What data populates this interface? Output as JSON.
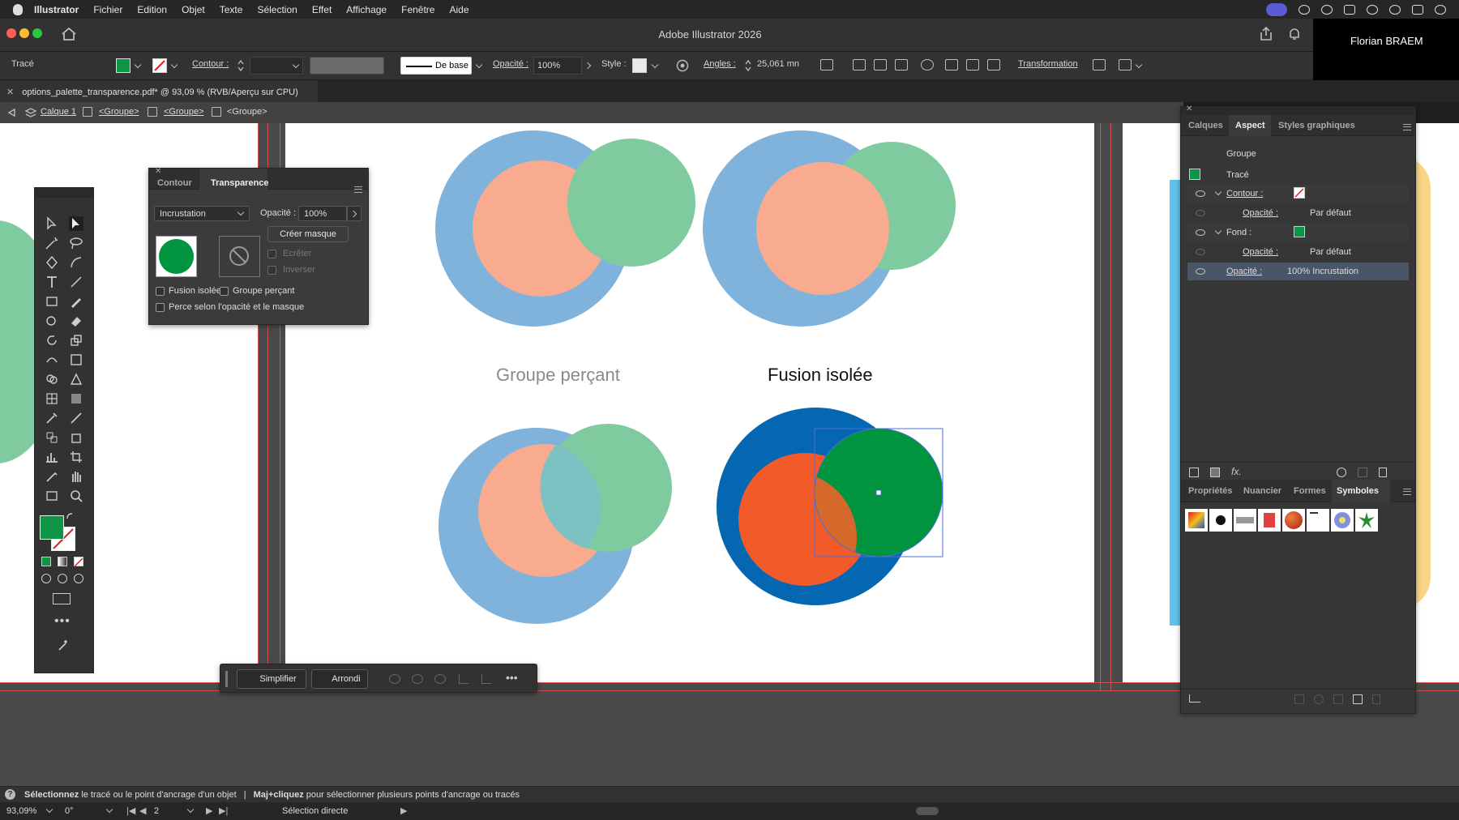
{
  "menubar": {
    "app_name": "Illustrator",
    "items": [
      "Fichier",
      "Edition",
      "Objet",
      "Texte",
      "Sélection",
      "Effet",
      "Affichage",
      "Fenêtre",
      "Aide"
    ]
  },
  "titlebar": {
    "title": "Adobe Illustrator 2026"
  },
  "user": {
    "name": "Florian BRAEM"
  },
  "controlbar": {
    "selection_type": "Tracé",
    "contour_label": "Contour :",
    "stroke_profile": "De base",
    "opacity_label": "Opacité :",
    "opacity_value": "100%",
    "style_label": "Style :",
    "angles_label": "Angles :",
    "angles_value": "25,061 mn",
    "transformation_label": "Transformation",
    "fill_color": "#0d9447"
  },
  "document_tab": {
    "label": "options_palette_transparence.pdf* @ 93,09 % (RVB/Aperçu sur CPU)"
  },
  "breadcrumb": {
    "items": [
      "Calque 1",
      "<Groupe>",
      "<Groupe>",
      "<Groupe>"
    ]
  },
  "artboard": {
    "label_left": "Groupe perçant",
    "label_right": "Fusion isolée",
    "colors": {
      "light_blue": "#7fb3dc",
      "salmon": "#f8ab8e",
      "mint": "#7fca9f",
      "dark_blue": "#0567b1",
      "orange": "#f25a2a",
      "green": "#00943f",
      "overlap": "#d5682b"
    }
  },
  "transparency_panel": {
    "tabs": [
      "Contour",
      "Transparence"
    ],
    "active_tab": "Transparence",
    "blend_mode": "Incrustation",
    "opacity_label": "Opacité :",
    "opacity_value": "100%",
    "create_mask_button": "Créer masque",
    "clip_label": "Ecrêter",
    "invert_label": "Inverser",
    "isolated_blend_label": "Fusion isolée",
    "knockout_group_label": "Groupe perçant",
    "opacity_mask_knockout_label": "Perce selon l'opacité et le masque"
  },
  "context_bar": {
    "simplify_label": "Simplifier",
    "round_label": "Arrondi"
  },
  "appearance_panel": {
    "tabs": [
      "Calques",
      "Aspect",
      "Styles graphiques"
    ],
    "active_tab": "Aspect",
    "group_label": "Groupe",
    "path_label": "Tracé",
    "stroke_label": "Contour :",
    "stroke_opacity_label": "Opacité :",
    "stroke_opacity_value": "Par défaut",
    "fill_label": "Fond :",
    "fill_opacity_label": "Opacité :",
    "fill_opacity_value": "Par défaut",
    "object_opacity_label": "Opacité :",
    "object_opacity_value": "100% Incrustation"
  },
  "symbols_panel": {
    "tabs": [
      "Propriétés",
      "Nuancier",
      "Formes",
      "Symboles"
    ],
    "active_tab": "Symboles"
  },
  "statusbar": {
    "hint_bold1": "Sélectionnez",
    "hint_text1": "le tracé ou le point d'ancrage d'un objet",
    "hint_separator": "|",
    "hint_bold2": "Maj+cliquez",
    "hint_text2": "pour sélectionner plusieurs points d'ancrage ou tracés"
  },
  "bottombar": {
    "zoom": "93,09%",
    "rotation": "0°",
    "artboard_number": "2",
    "tool_name": "Sélection directe"
  }
}
